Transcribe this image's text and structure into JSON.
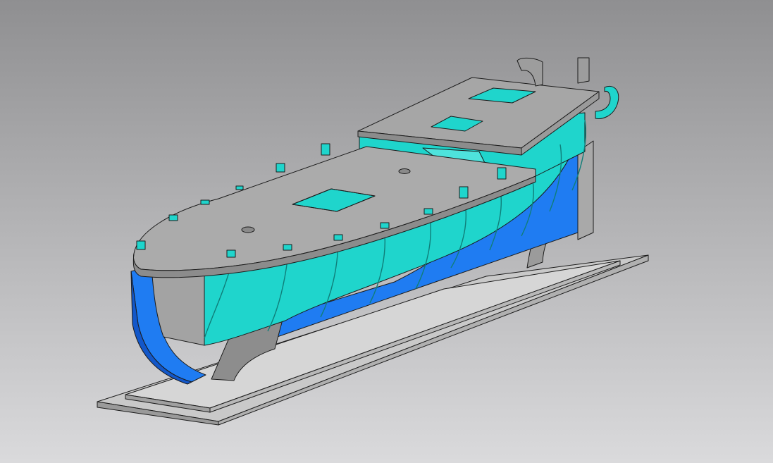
{
  "viewport": {
    "background_top": "#8f8f91",
    "background_bottom": "#dadadc"
  },
  "colors": {
    "stand_light": "#d4d4d4",
    "stand_mid": "#c2c2c2",
    "stand_dark": "#9a9a9a",
    "deck_top": "#ababab",
    "deck_edge": "#8c8c8c",
    "hull_cyan": "#1fd5cc",
    "hull_cyan_light": "#4ee3dc",
    "hull_cyan_dark": "#13a9a3",
    "keel_blue": "#1f7cf2",
    "keel_blue_dark": "#1257c9",
    "outline": "#1b1b1b"
  }
}
